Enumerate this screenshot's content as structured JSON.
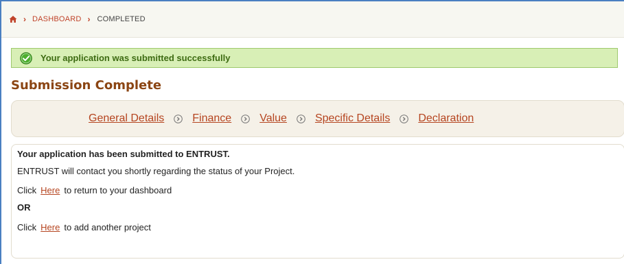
{
  "breadcrumb": {
    "items": [
      {
        "label": "DASHBOARD"
      },
      {
        "label": "COMPLETED"
      }
    ]
  },
  "alert": {
    "message": "Your application was submitted successfully"
  },
  "title": "Submission Complete",
  "steps": [
    {
      "label": "General Details"
    },
    {
      "label": "Finance"
    },
    {
      "label": "Value"
    },
    {
      "label": "Specific Details"
    },
    {
      "label": "Declaration"
    }
  ],
  "content": {
    "heading": "Your application has been submitted to ENTRUST.",
    "message": "ENTRUST will contact you shortly regarding the status of your Project.",
    "return_prefix": "Click",
    "return_link": "Here",
    "return_suffix": "to return to your dashboard",
    "or_text": "OR",
    "add_prefix": "Click",
    "add_link": "Here",
    "add_suffix": "to add another project"
  },
  "colors": {
    "accent": "#b5441f",
    "title": "#8b4513",
    "success_bg": "#d8efb6",
    "success_text": "#3d6b12"
  },
  "icons": {
    "home": "home-icon",
    "crumb_separator": "chevron-right-icon",
    "success": "check-circle-icon",
    "step_separator": "circle-chevron-right-icon"
  }
}
